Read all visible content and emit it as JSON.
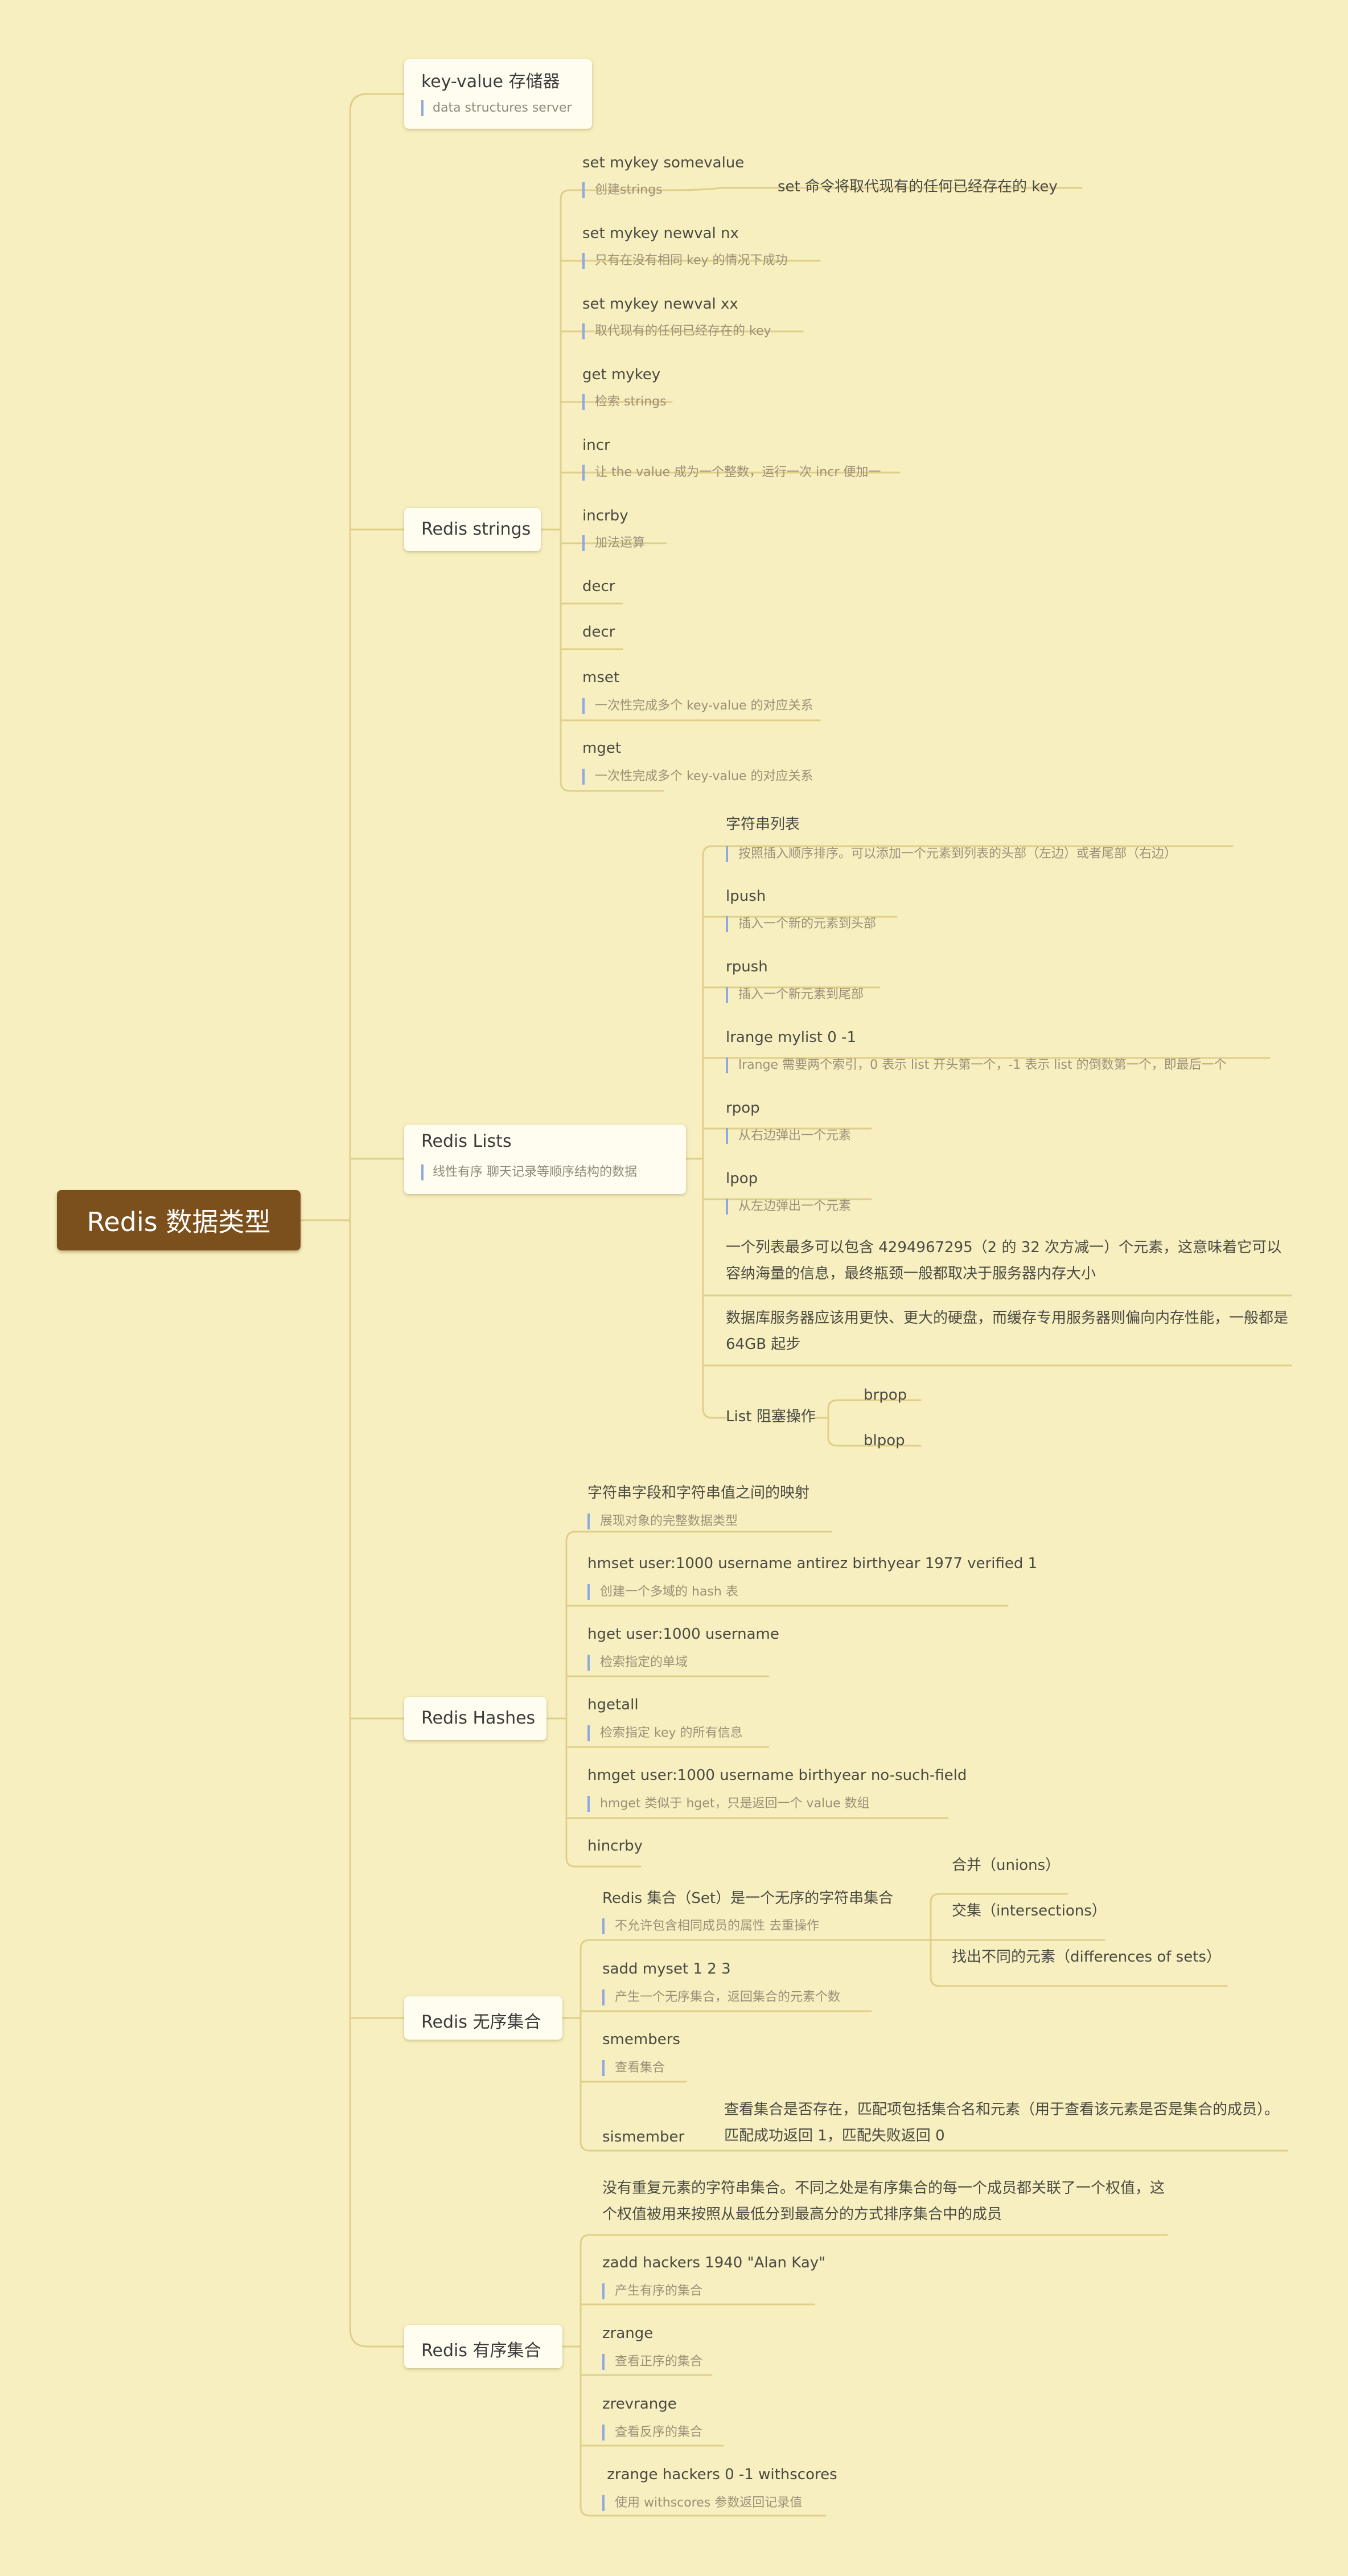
{
  "root": "Redis 数据类型",
  "branches": {
    "kv": {
      "title": "key-value 存储器",
      "note": "data structures server"
    },
    "strings": {
      "title": "Redis strings",
      "items": [
        {
          "t": "set mykey somevalue",
          "n": "创建strings",
          "side": "set 命令将取代现有的任何已经存在的 key"
        },
        {
          "t": "set mykey newval nx",
          "n": "只有在没有相同 key 的情况下成功"
        },
        {
          "t": "set mykey newval xx",
          "n": "取代现有的任何已经存在的 key"
        },
        {
          "t": "get mykey",
          "n": "检索 strings"
        },
        {
          "t": "incr",
          "n": "让 the value 成为一个整数，运行一次 incr 便加一"
        },
        {
          "t": "incrby",
          "n": "加法运算"
        },
        {
          "t": "decr"
        },
        {
          "t": "decr"
        },
        {
          "t": "mset",
          "n": "一次性完成多个 key-value 的对应关系"
        },
        {
          "t": "mget",
          "n": "一次性完成多个 key-value 的对应关系"
        }
      ]
    },
    "lists": {
      "title": "Redis Lists",
      "note": "线性有序 聊天记录等顺序结构的数据",
      "items": [
        {
          "t": "字符串列表",
          "n": "按照插入顺序排序。可以添加一个元素到列表的头部（左边）或者尾部（右边）"
        },
        {
          "t": "lpush",
          "n": "插入一个新的元素到头部"
        },
        {
          "t": "rpush",
          "n": "插入一个新元素到尾部"
        },
        {
          "t": "lrange mylist 0 -1",
          "n": "lrange 需要两个索引，0 表示 list 开头第一个，-1 表示 list 的倒数第一个，即最后一个"
        },
        {
          "t": "rpop",
          "n": "从右边弹出一个元素"
        },
        {
          "t": "lpop",
          "n": "从左边弹出一个元素"
        }
      ],
      "para1": "一个列表最多可以包含 4294967295（2 的 32 次方减一）个元素，这意味着它可以容纳海量的信息，最终瓶颈一般都取决于服务器内存大小",
      "para2": "数据库服务器应该用更快、更大的硬盘，而缓存专用服务器则偏向内存性能，一般都是 64GB 起步",
      "block": {
        "t": "List 阻塞操作",
        "children": [
          "brpop",
          "blpop"
        ]
      }
    },
    "hashes": {
      "title": "Redis Hashes",
      "items": [
        {
          "t": "字符串字段和字符串值之间的映射",
          "n": "展现对象的完整数据类型"
        },
        {
          "t": "hmset user:1000 username antirez birthyear 1977 verified 1",
          "n": "创建一个多域的 hash 表"
        },
        {
          "t": "hget user:1000 username",
          "n": "检索指定的单域"
        },
        {
          "t": "hgetall",
          "n": "检索指定 key 的所有信息"
        },
        {
          "t": "hmget user:1000 username birthyear no-such-field",
          "n": "hmget 类似于 hget，只是返回一个 value 数组"
        },
        {
          "t": "hincrby"
        }
      ]
    },
    "sets": {
      "title": "Redis 无序集合",
      "first": {
        "t": "Redis 集合（Set）是一个无序的字符串集合",
        "n": "不允许包含相同成员的属性 去重操作",
        "children": [
          "合并（unions）",
          "交集（intersections）",
          "找出不同的元素（differences of sets）"
        ]
      },
      "items": [
        {
          "t": "sadd myset 1 2 3",
          "n": "产生一个无序集合，返回集合的元素个数"
        },
        {
          "t": "smembers",
          "n": "查看集合"
        }
      ],
      "sismember": {
        "t": "sismember",
        "desc": "查看集合是否存在，匹配项包括集合名和元素（用于查看该元素是否是集合的成员）。匹配成功返回 1，匹配失败返回 0"
      }
    },
    "zsets": {
      "title": "Redis 有序集合",
      "intro": "没有重复元素的字符串集合。不同之处是有序集合的每一个成员都关联了一个权值，这个权值被用来按照从最低分到最高分的方式排序集合中的成员",
      "items": [
        {
          "t": "zadd hackers 1940 \"Alan Kay\"",
          "n": "产生有序的集合"
        },
        {
          "t": "zrange",
          "n": "查看正序的集合"
        },
        {
          "t": "zrevrange",
          "n": "查看反序的集合"
        },
        {
          "t": " zrange hackers 0 -1 withscores",
          "n": "使用 withscores 参数返回记录值"
        }
      ]
    }
  },
  "colors": {
    "background": "#f7efbf",
    "root": "#7b501c",
    "line": "#e0cf8a",
    "note_bar": "#8fa8e0"
  }
}
